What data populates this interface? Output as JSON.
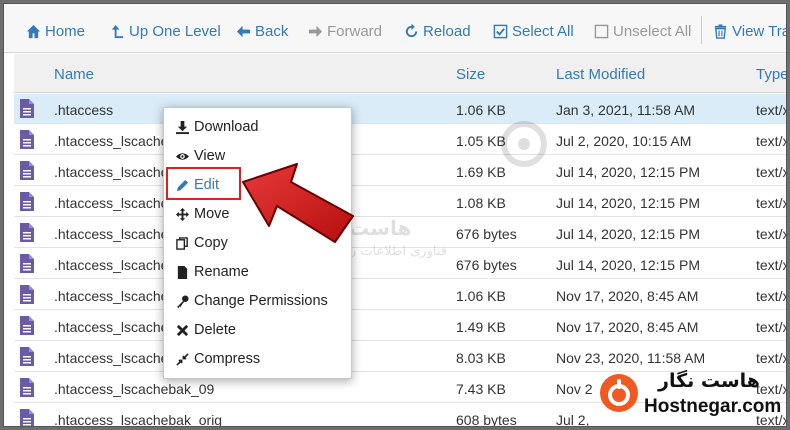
{
  "toolbar": {
    "items": [
      {
        "label": "Home",
        "icon": "home-icon"
      },
      {
        "label": "Up One Level",
        "icon": "up-level-icon"
      },
      {
        "label": "Back",
        "icon": "arrow-left-icon"
      },
      {
        "label": "Forward",
        "icon": "arrow-right-icon"
      },
      {
        "label": "Reload",
        "icon": "reload-icon"
      },
      {
        "label": "Select All",
        "icon": "checkbox-checked-icon"
      },
      {
        "label": "Unselect All",
        "icon": "checkbox-empty-icon"
      },
      {
        "label": "View Tras",
        "icon": "trash-icon"
      }
    ]
  },
  "table": {
    "headers": {
      "name": "Name",
      "size": "Size",
      "modified": "Last Modified",
      "type": "Type"
    },
    "rows": [
      {
        "name": ".htaccess",
        "size": "1.06 KB",
        "modified": "Jan 3, 2021, 11:58 AM",
        "type": "text/x"
      },
      {
        "name": ".htaccess_lscache",
        "size": "1.05 KB",
        "modified": "Jul 2, 2020, 10:15 AM",
        "type": "text/x"
      },
      {
        "name": ".htaccess_lscache",
        "size": "1.69 KB",
        "modified": "Jul 14, 2020, 12:15 PM",
        "type": "text/x"
      },
      {
        "name": ".htaccess_lscache",
        "size": "1.08 KB",
        "modified": "Jul 14, 2020, 12:15 PM",
        "type": "text/x"
      },
      {
        "name": ".htaccess_lscache",
        "size": "676 bytes",
        "modified": "Jul 14, 2020, 12:15 PM",
        "type": "text/x"
      },
      {
        "name": ".htaccess_lscache",
        "size": "676 bytes",
        "modified": "Jul 14, 2020, 12:15 PM",
        "type": "text/x"
      },
      {
        "name": ".htaccess_lscache",
        "size": "1.06 KB",
        "modified": "Nov 17, 2020, 8:45 AM",
        "type": "text/x"
      },
      {
        "name": ".htaccess_lscache",
        "size": "1.49 KB",
        "modified": "Nov 17, 2020, 8:45 AM",
        "type": "text/x"
      },
      {
        "name": ".htaccess_lscache",
        "size": "8.03 KB",
        "modified": "Nov 23, 2020, 11:58 AM",
        "type": "text/x"
      },
      {
        "name": ".htaccess_lscachebak_09",
        "size": "7.43 KB",
        "modified": "Nov 2",
        "type": "text/x"
      },
      {
        "name": ".htaccess_lscachebak_orig",
        "size": "608 bytes",
        "modified": "Jul 2,",
        "type": "text/x"
      }
    ]
  },
  "context_menu": {
    "items": [
      {
        "label": "Download",
        "icon": "download-icon"
      },
      {
        "label": "View",
        "icon": "eye-icon"
      },
      {
        "label": "Edit",
        "icon": "pencil-icon"
      },
      {
        "label": "Move",
        "icon": "move-arrows-icon"
      },
      {
        "label": "Copy",
        "icon": "copy-icon"
      },
      {
        "label": "Rename",
        "icon": "file-icon"
      },
      {
        "label": "Change Permissions",
        "icon": "key-icon"
      },
      {
        "label": "Delete",
        "icon": "x-icon"
      },
      {
        "label": "Compress",
        "icon": "compress-icon"
      }
    ]
  },
  "branding": {
    "name_fa": "هاست نگار",
    "name_en": "Hostnegar.com",
    "watermark_fa": "هاست نگار",
    "watermark_sub_fa": "فناوری اطلاعات رایان نگار",
    "accent": "#f05a22"
  },
  "colors": {
    "link": "#337ab7",
    "selected_row": "#d9ecf8",
    "highlight_box": "#e01f1f",
    "arrow": "#d11a1a"
  }
}
